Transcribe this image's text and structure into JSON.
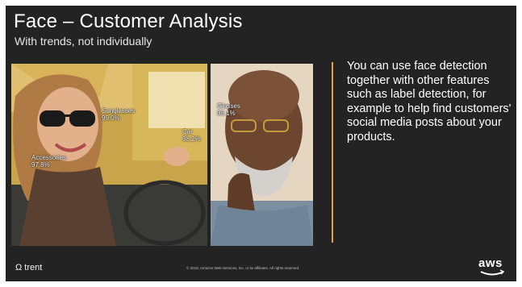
{
  "slide": {
    "title": "Face – Customer Analysis",
    "subtitle": "With trends, not individually",
    "body": "You can use face detection together with other features such as label detection, for example to help find customers' social media posts about your products.",
    "footer_left": "Ω trent",
    "footer_center": "© 2019, Amazon Web Services, Inc. or its affiliates. All rights reserved.",
    "logo_text": "aws",
    "accent_color": "#e0a340",
    "background_color": "#232323"
  },
  "photo_left": {
    "tags": [
      {
        "label": "Sunglasses",
        "value": "99.0%"
      },
      {
        "label": "Car",
        "value": "98.2%"
      },
      {
        "label": "Accessories",
        "value": "97.8%"
      }
    ]
  },
  "photo_right": {
    "tags": [
      {
        "label": "Glasses",
        "value": "99.1%"
      }
    ]
  }
}
